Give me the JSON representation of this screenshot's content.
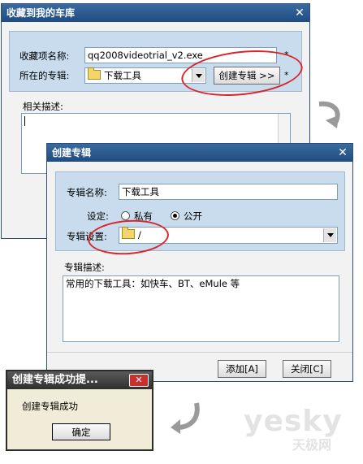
{
  "collect_dialog": {
    "title": "收藏到我的车库",
    "name_label": "收藏项名称:",
    "name_value": "qq2008videotrial_v2.exe",
    "album_label": "所在的专辑:",
    "album_value": "下载工具",
    "create_album_button": "创建专辑 >>",
    "required_mark": "*",
    "desc_label": "相关描述:"
  },
  "create_dialog": {
    "title": "创建专辑",
    "name_label": "专辑名称:",
    "name_value": "下载工具",
    "setting_label": "设定:",
    "private_label": "私有",
    "public_label": "公开",
    "selected_visibility": "public",
    "location_label": "专辑设置:",
    "location_value": "/",
    "desc_label": "专辑描述:",
    "desc_value": "常用的下载工具：如快车、BT、eMule 等",
    "add_button": "添加[A]",
    "close_button": "关闭[C]"
  },
  "success_dialog": {
    "title": "创建专辑成功提...",
    "message": "创建专辑成功",
    "ok_button": "确定"
  },
  "watermark": {
    "brand": "yesky",
    "brand_cn": "天极网"
  },
  "colors": {
    "titlebar": "#2b5a8f",
    "panel": "#c8dced",
    "highlight": "#d8262c",
    "success_title": "#3b3b3b"
  }
}
